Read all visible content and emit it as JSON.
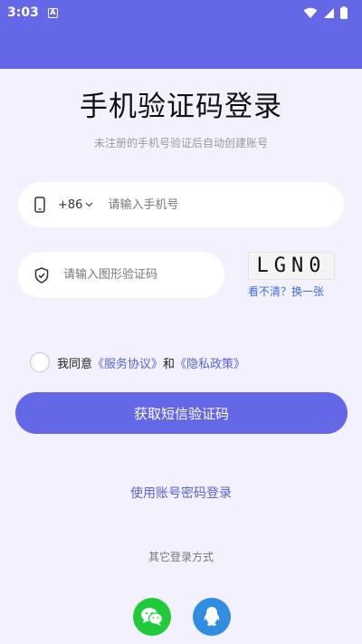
{
  "status_bar": {
    "time": "3:03",
    "indicator": "A"
  },
  "title": "手机验证码登录",
  "subtitle": "未注册的手机号验证后自动创建账号",
  "phone": {
    "country_code": "+86",
    "placeholder": "请输入手机号"
  },
  "captcha": {
    "placeholder": "请输入图形验证码",
    "code": "LGN0",
    "refresh_label": "看不清？换一张"
  },
  "agreement": {
    "prefix": "我同意",
    "service_link": "《服务协议》",
    "conjunction": "和",
    "privacy_link": "《隐私政策》"
  },
  "sms_button": "获取短信验证码",
  "password_login": "使用账号密码登录",
  "other_login_label": "其它登录方式",
  "social_icons": [
    "wechat-icon",
    "qq-icon"
  ],
  "colors": {
    "primary": "#6467e6",
    "background": "#f2f1fd",
    "link": "#5b63d9",
    "wechat": "#1fcb3a",
    "qq": "#2f8ee0"
  }
}
